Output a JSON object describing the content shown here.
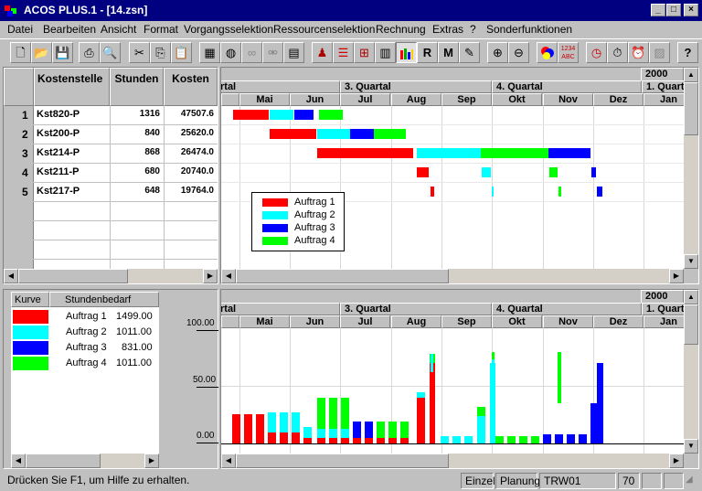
{
  "title": "ACOS PLUS.1 - [14.zsn]",
  "menu": [
    "Datei",
    "Bearbeiten",
    "Ansicht",
    "Format",
    "Vorgangsselektion",
    "Ressourcenselektion",
    "Rechnung",
    "Extras",
    "?",
    "Sonderfunktionen"
  ],
  "toolbar_icons": [
    "new-file-icon",
    "open-folder-icon",
    "save-icon",
    "print-icon",
    "print-preview-icon",
    "cut-icon",
    "copy-icon",
    "paste-icon",
    "calc-icon",
    "globe-icon",
    "link-icon",
    "unlink-icon",
    "calendar-icon",
    "resources-icon",
    "gantt-icon",
    "network-icon",
    "table-icon",
    "histogram-icon",
    "r-icon",
    "m-icon",
    "pen-icon",
    "zoom-in-icon",
    "zoom-out-icon",
    "colors-icon",
    "numbers-icon",
    "clock-icon",
    "timer-icon",
    "alarm-icon",
    "chart-icon",
    "help-icon"
  ],
  "table": {
    "headers": [
      "Kostenstelle",
      "Stunden",
      "Kosten"
    ],
    "rows": [
      {
        "num": "1",
        "name": "Kst820-P",
        "stunden": "1316",
        "kosten": "47507.6"
      },
      {
        "num": "2",
        "name": "Kst200-P",
        "stunden": "840",
        "kosten": "25620.0"
      },
      {
        "num": "3",
        "name": "Kst214-P",
        "stunden": "868",
        "kosten": "26474.0"
      },
      {
        "num": "4",
        "name": "Kst211-P",
        "stunden": "680",
        "kosten": "20740.0"
      },
      {
        "num": "5",
        "name": "Kst217-P",
        "stunden": "648",
        "kosten": "19764.0"
      }
    ]
  },
  "timeline": {
    "year": "2000",
    "quarters": [
      "rtal",
      "3. Quartal",
      "4. Quartal",
      "1. Quart"
    ],
    "months": [
      "Mai",
      "Jun",
      "Jul",
      "Aug",
      "Sep",
      "Okt",
      "Nov",
      "Dez",
      "Jan"
    ]
  },
  "colors": {
    "a1": "#ff0000",
    "a2": "#00ffff",
    "a3": "#0000ff",
    "a4": "#00ff00"
  },
  "legend": [
    "Auftrag 1",
    "Auftrag 2",
    "Auftrag 3",
    "Auftrag 4"
  ],
  "kurve": {
    "headers": [
      "Kurve",
      "Stundenbedarf"
    ],
    "rows": [
      {
        "name": "Auftrag 1",
        "value": "1499.00",
        "color": "#ff0000"
      },
      {
        "name": "Auftrag 2",
        "value": "1011.00",
        "color": "#00ffff"
      },
      {
        "name": "Auftrag 3",
        "value": "831.00",
        "color": "#0000ff"
      },
      {
        "name": "Auftrag 4",
        "value": "1011.00",
        "color": "#00ff00"
      }
    ]
  },
  "yaxis": [
    "100.00",
    "50.00",
    "0.00"
  ],
  "status": {
    "help": "Drücken Sie F1, um Hilfe zu erhalten.",
    "p1": "Einzel",
    "p2": "Planung",
    "p3": "TRW01",
    "p4": "70"
  }
}
